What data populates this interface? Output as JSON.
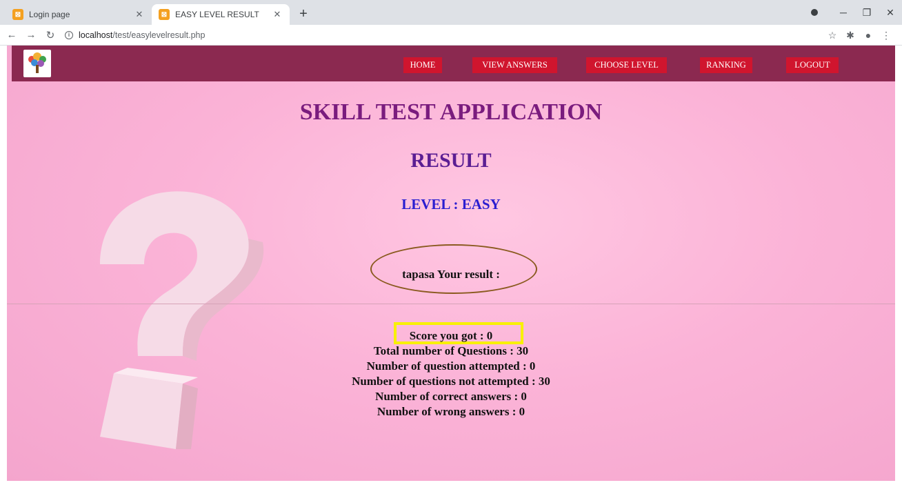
{
  "browser": {
    "tabs": [
      {
        "title": "Login page",
        "favicon": "xampp-icon",
        "active": false
      },
      {
        "title": "EASY LEVEL RESULT",
        "favicon": "xampp-icon",
        "active": true
      }
    ],
    "url_host": "localhost",
    "url_path": "/test/easylevelresult.php"
  },
  "nav": {
    "items": [
      "HOME",
      "VIEW ANSWERS",
      "CHOOSE LEVEL",
      "RANKING",
      "LOGOUT"
    ]
  },
  "main": {
    "app_title": "SKILL TEST APPLICATION",
    "result_heading": "RESULT",
    "level": "LEVEL : EASY",
    "greeting": "tapasa Your result :",
    "stats": [
      "Score you got : 0",
      "Total number of Questions : 30",
      "Number of question attempted : 0",
      "Number of questions not attempted : 30",
      "Number of correct answers : 0",
      "Number of wrong answers : 0"
    ]
  },
  "colors": {
    "navbar": "#8b2950",
    "nav_button": "#d0152e",
    "title": "#7a1c7e",
    "level": "#2b1ed0",
    "highlight_ellipse": "#8a5a1f",
    "highlight_box": "#f8f000"
  }
}
